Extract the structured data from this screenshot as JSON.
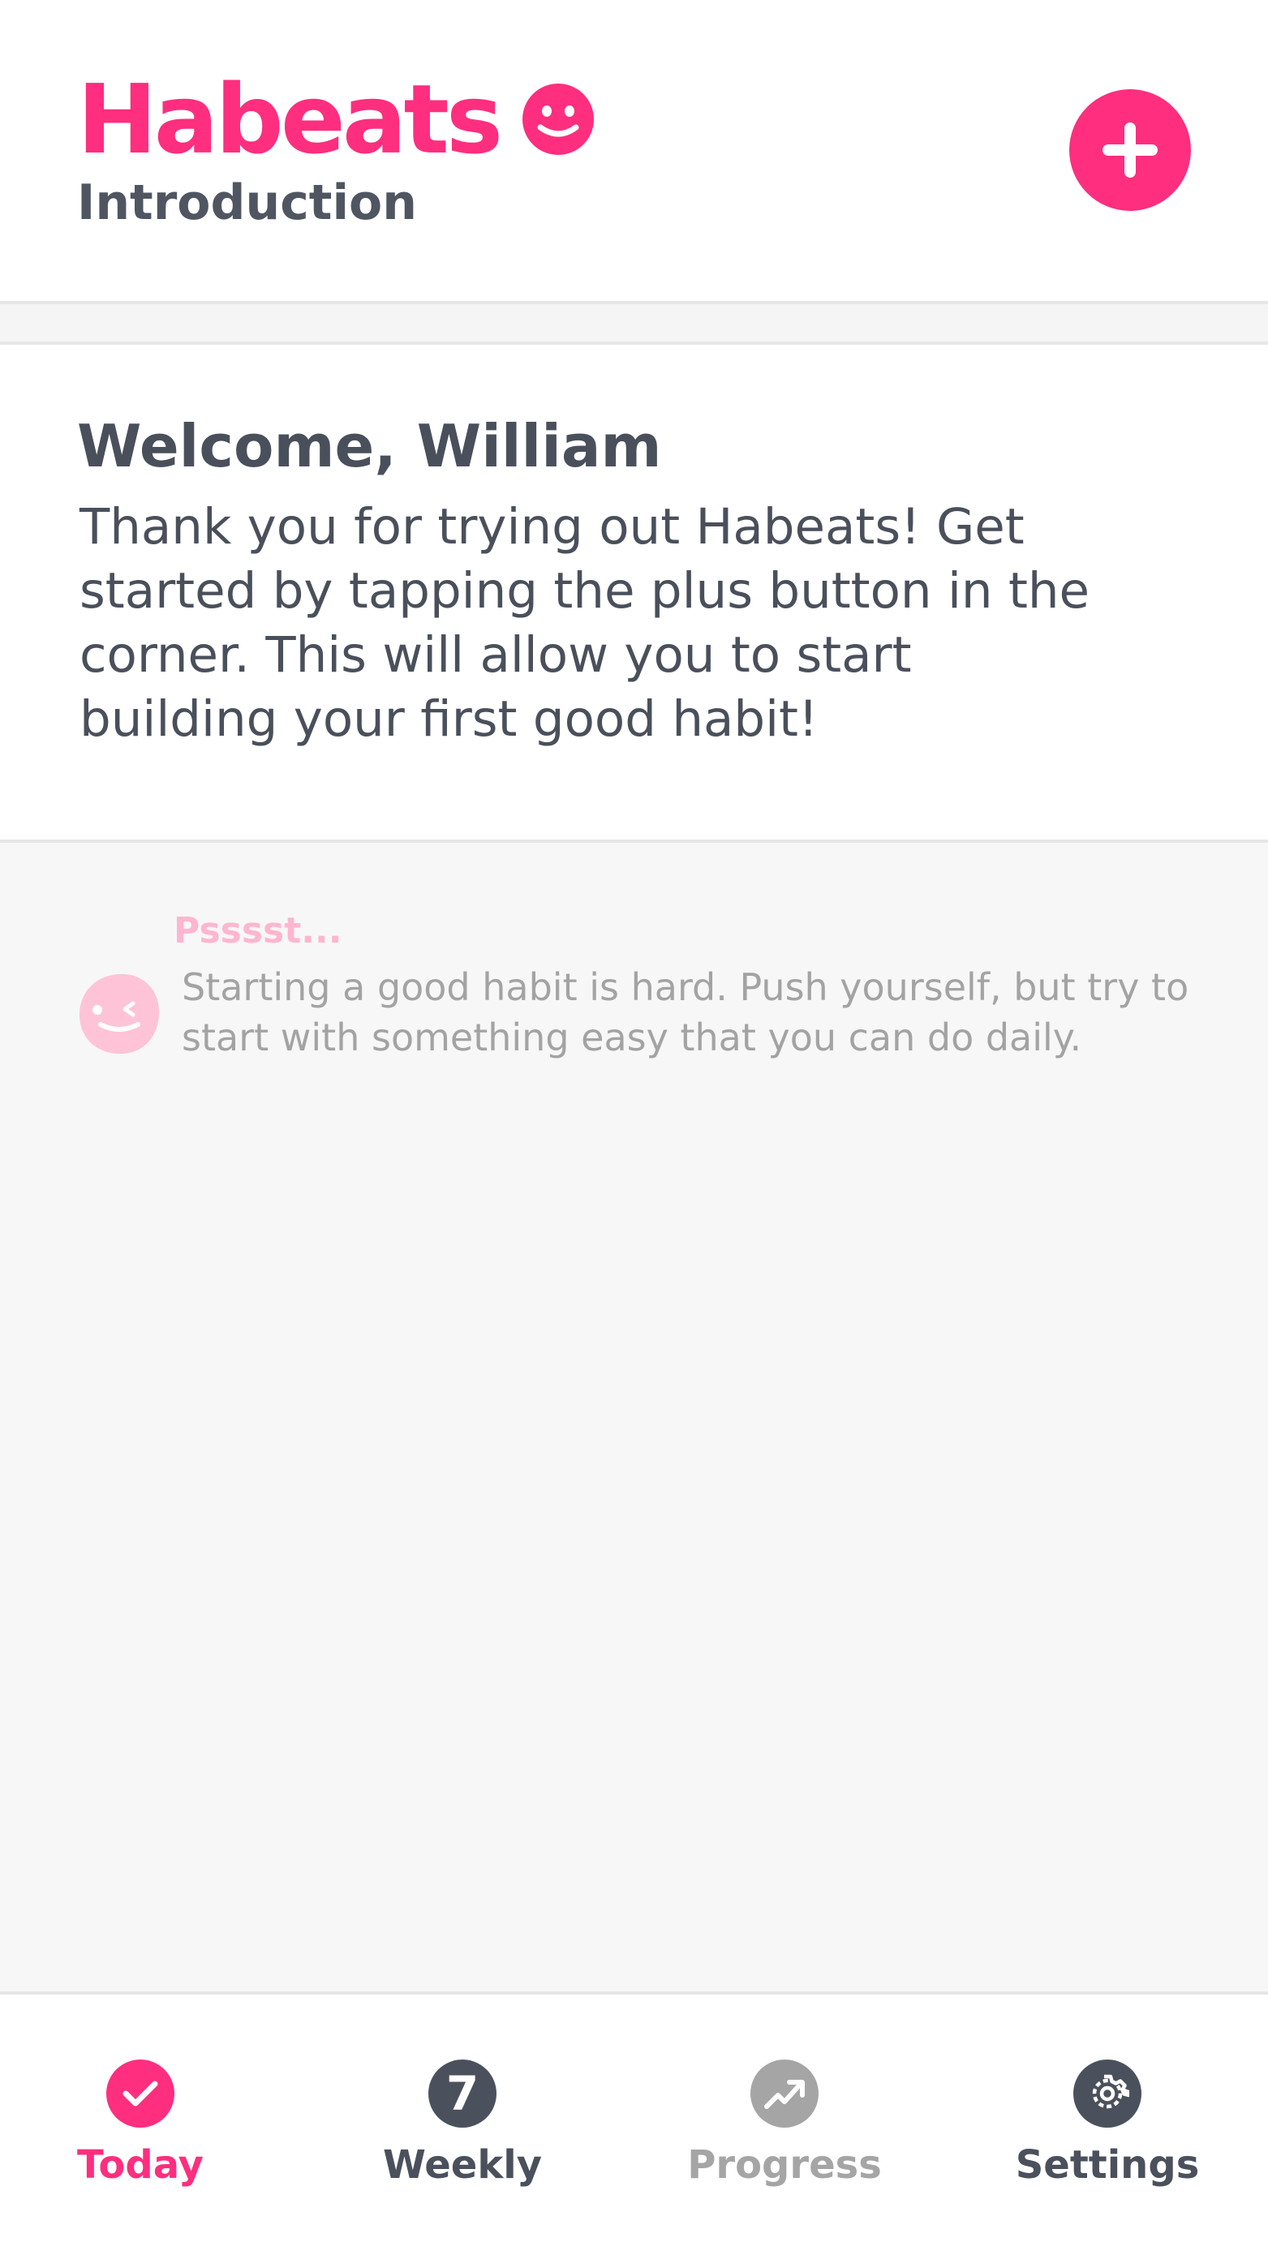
{
  "colors": {
    "brand": "#ff2e7e",
    "text_dark": "#4a505b",
    "text_muted": "#a3a3a3",
    "tip_label": "#ffb6cf",
    "background": "#f7f7f7"
  },
  "header": {
    "title": "Habeats",
    "title_icon": "smiley-face-icon",
    "subtitle": "Introduction",
    "add_button_icon": "plus-icon"
  },
  "welcome": {
    "title": "Welcome, William",
    "body": "Thank you for trying out Habeats! Get started by tapping the plus button in the corner. This will allow you to start building your first good habit!"
  },
  "tip": {
    "label": "Psssst...",
    "icon": "winking-face-icon",
    "text": "Starting a good habit is hard. Push yourself, but try to start with something easy that you can do daily."
  },
  "bottom_nav": {
    "items": [
      {
        "label": "Today",
        "icon": "check-circle-icon",
        "active": true
      },
      {
        "label": "Weekly",
        "icon": "seven-circle-icon",
        "badge": "7",
        "active": false
      },
      {
        "label": "Progress",
        "icon": "trend-up-icon",
        "active": false,
        "disabled": true
      },
      {
        "label": "Settings",
        "icon": "gear-icon",
        "active": false
      }
    ]
  }
}
